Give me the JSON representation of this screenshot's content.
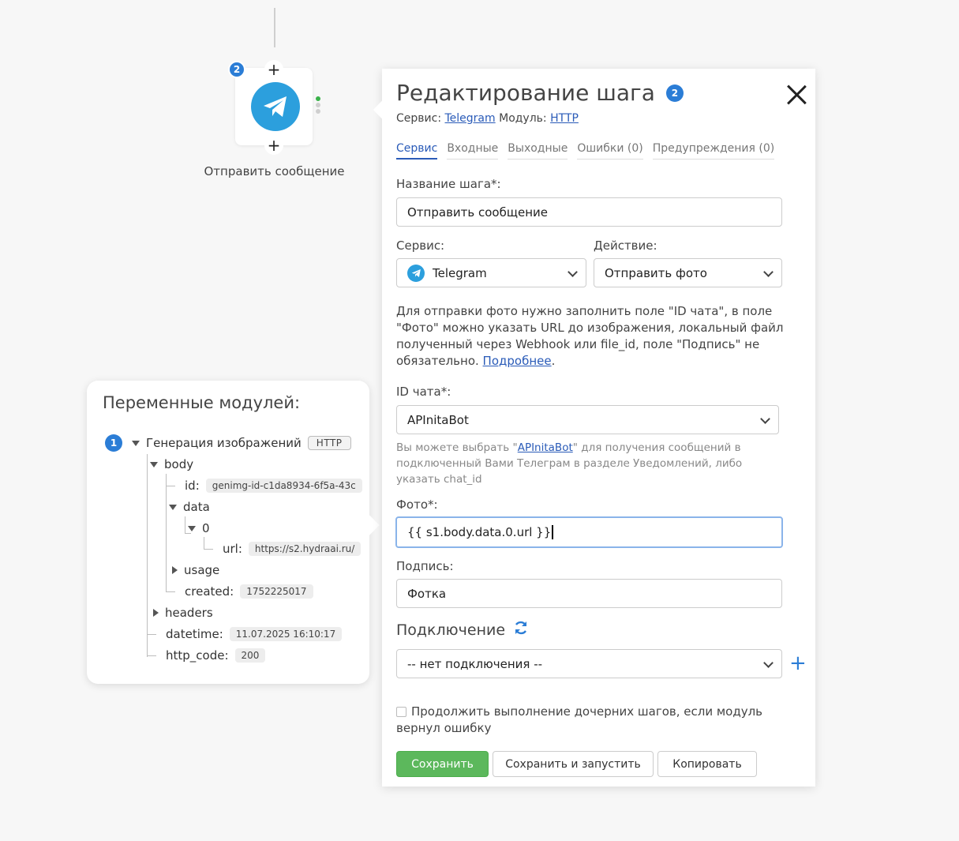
{
  "canvas": {
    "node_badge": "2",
    "node_label": "Отправить сообщение",
    "plus_symbol": "+"
  },
  "vars_panel": {
    "title": "Переменные модулей:",
    "module": {
      "badge": "1",
      "name": "Генерация изображений",
      "tag": "HTTP"
    },
    "tree": {
      "body": "body",
      "id_key": "id:",
      "id_value": "genimg-id-c1da8934-6f5a-43c",
      "data": "data",
      "index0": "0",
      "url_key": "url:",
      "url_value": "https://s2.hydraai.ru/",
      "usage": "usage",
      "created_key": "created:",
      "created_value": "1752225017",
      "headers": "headers",
      "datetime_key": "datetime:",
      "datetime_value": "11.07.2025 16:10:17",
      "http_code_key": "http_code:",
      "http_code_value": "200"
    }
  },
  "panel": {
    "title": "Редактирование шага",
    "badge": "2",
    "service_label": "Сервис:",
    "service_link": "Telegram",
    "module_label": "Модуль:",
    "module_link": "HTTP",
    "tabs": [
      {
        "label": "Сервис",
        "active": true
      },
      {
        "label": "Входные",
        "active": false
      },
      {
        "label": "Выходные",
        "active": false
      },
      {
        "label": "Ошибки (0)",
        "active": false
      },
      {
        "label": "Предупреждения (0)",
        "active": false
      }
    ],
    "step_name_label": "Название шага*:",
    "step_name_value": "Отправить сообщение",
    "service_field_label": "Сервис:",
    "service_value": "Telegram",
    "action_label": "Действие:",
    "action_value": "Отправить фото",
    "description": "Для отправки фото нужно заполнить поле \"ID чата\", в поле \"Фото\" можно указать URL до изображения, локальный файл полученный через Webhook или file_id, поле \"Подпись\" не обязательно. ",
    "description_link": "Подробнее",
    "description_end": ".",
    "chat_id_label": "ID чата*:",
    "chat_id_value": "APInitaBot",
    "hint_before": "Вы можете выбрать \"",
    "hint_link": "APInitaBot",
    "hint_after": "\" для получения сообщений в подключенный Вами Телеграм в разделе Уведомлений, либо указать chat_id",
    "photo_label": "Фото*:",
    "photo_value": "{{ s1.body.data.0.url }}",
    "caption_label": "Подпись:",
    "caption_value": "Фотка",
    "connection_title": "Подключение",
    "connection_value": "-- нет подключения --",
    "add_symbol": "+",
    "continue_checkbox": "Продолжить выполнение дочерних шагов, если модуль вернул ошибку",
    "save_button": "Сохранить",
    "save_run_button": "Сохранить и запустить",
    "copy_button": "Копировать"
  },
  "colors": {
    "accent": "#2b7dd6",
    "telegram": "#2c9fdd",
    "success": "#5cb85c",
    "link": "#2a5bb8"
  }
}
